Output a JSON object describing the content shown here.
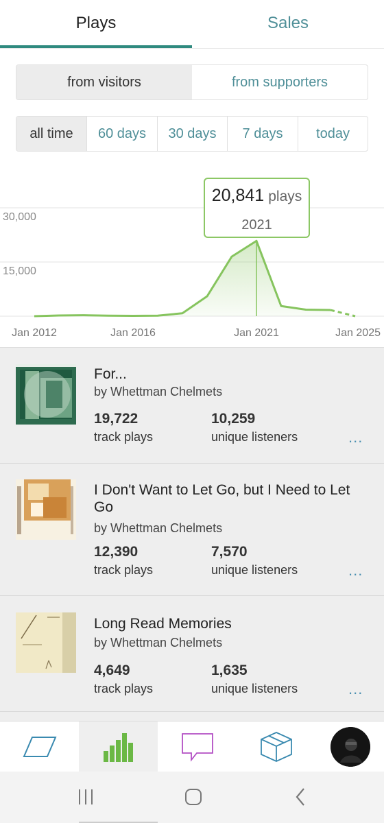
{
  "tabs": [
    {
      "label": "Plays",
      "active": true
    },
    {
      "label": "Sales",
      "active": false
    }
  ],
  "source_filter": {
    "options": [
      "from visitors",
      "from supporters"
    ],
    "selected": "from visitors"
  },
  "time_filter": {
    "options": [
      "all time",
      "60 days",
      "30 days",
      "7 days",
      "today"
    ],
    "selected": "all time"
  },
  "tooltip": {
    "value": "20,841",
    "unit": "plays",
    "year": "2021"
  },
  "chart_data": {
    "type": "area",
    "x": [
      2012,
      2013,
      2014,
      2015,
      2016,
      2017,
      2018,
      2019,
      2020,
      2021,
      2022,
      2023,
      2024,
      2025
    ],
    "values": [
      0,
      200,
      250,
      150,
      100,
      150,
      800,
      5500,
      16500,
      20841,
      2800,
      1800,
      1700,
      0
    ],
    "projected_from": 2024,
    "yticks": [
      "30,000",
      "15,000"
    ],
    "ytick_values": [
      30000,
      15000
    ],
    "xticks": [
      "Jan 2012",
      "Jan 2016",
      "Jan 2021",
      "Jan 2025"
    ],
    "xtick_values": [
      2012,
      2016,
      2021,
      2025
    ],
    "ylim": [
      0,
      30000
    ],
    "highlight_x": 2021,
    "color": "#86c45e",
    "grid": true
  },
  "tracks": [
    {
      "title": "For...",
      "artist": "by Whettman Chelmets",
      "plays": "19,722",
      "plays_label": "track plays",
      "listeners": "10,259",
      "listeners_label": "unique listeners",
      "more": "..."
    },
    {
      "title": "I Don't Want to Let Go, but I Need to Let Go",
      "artist": "by Whettman Chelmets",
      "plays": "12,390",
      "plays_label": "track plays",
      "listeners": "7,570",
      "listeners_label": "unique listeners",
      "more": "..."
    },
    {
      "title": "Long Read Memories",
      "artist": "by Whettman Chelmets",
      "plays": "4,649",
      "plays_label": "track plays",
      "listeners": "1,635",
      "listeners_label": "unique listeners",
      "more": "..."
    }
  ],
  "bottom_nav": {
    "icons": [
      "feed-icon",
      "stats-icon",
      "messages-icon",
      "orders-icon",
      "profile-avatar"
    ],
    "active": "stats-icon"
  },
  "system_nav": {
    "icons": [
      "recents-icon",
      "home-icon",
      "back-icon"
    ]
  }
}
